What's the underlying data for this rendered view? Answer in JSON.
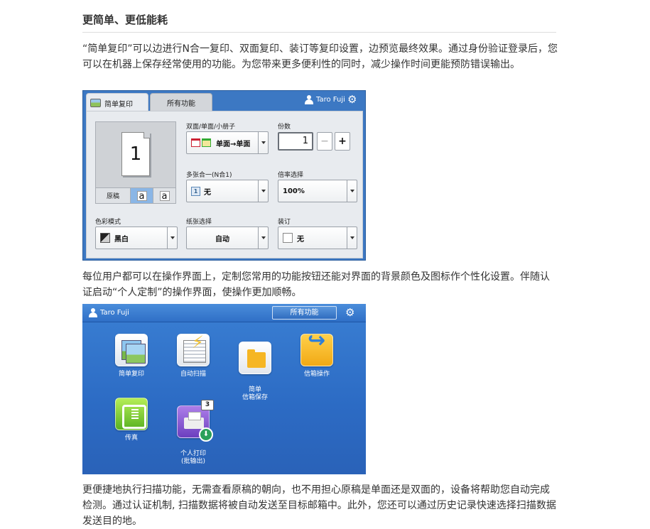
{
  "heading": "更简单、更低能耗",
  "paragraphs": {
    "p1": "“简单复印”可以边进行N合一复印、双面复印、装订等复印设置，边预览最终效果。通过身份验证登录后，您可以在机器上保存经常使用的功能。为您带来更多便利性的同时，减少操作时间更能预防错误输出。",
    "p2": "每位用户都可以在操作界面上，定制您常用的功能按钮还能对界面的背景颜色及图标作个性化设置。伴随认证启动“个人定制”的操作界面，使操作更加顺畅。",
    "p3": "更便捷地执行扫描功能，无需查看原稿的朝向，也不用担心原稿是单面还是双面的，设备将帮助您自动完成检测。通过认证机制, 扫描数据将被自动发送至目标邮箱中。此外，您还可以通过历史记录快速选择扫描数据发送目的地。"
  },
  "screen1": {
    "tabs": {
      "simple_copy": "简单复印",
      "all_functions": "所有功能"
    },
    "user": "Taro Fuji",
    "preview": {
      "page_number": "1",
      "original_label": "原稿",
      "orient_a1": "a",
      "orient_a2": "a"
    },
    "duplex": {
      "label": "双面/单面/小册子",
      "value": "单面→单面"
    },
    "copies": {
      "label": "份数",
      "value": "1",
      "minus": "−",
      "plus": "+"
    },
    "nup": {
      "label": "多张合一(N合1)",
      "value": "无",
      "icon_text": "1"
    },
    "zoom": {
      "label": "倍率选择",
      "value": "100%"
    },
    "color": {
      "label": "色彩模式",
      "value": "黑白"
    },
    "paper": {
      "label": "纸张选择",
      "value": "自动"
    },
    "staple": {
      "label": "装订",
      "value": "无"
    },
    "colors": {
      "frame": "#3c78c3",
      "panel": "#e8ebef",
      "active_orient": "#8ab6e6"
    }
  },
  "screen2": {
    "user": "Taro Fuji",
    "all_functions": "所有功能",
    "apps": [
      {
        "id": "simple-copy",
        "label": "简单复印"
      },
      {
        "id": "auto-scan",
        "label": "自动扫描"
      },
      {
        "id": "simple-mailbox-save",
        "label": "简单\n信箱保存"
      },
      {
        "id": "mailbox-operation",
        "label": "信箱操作"
      },
      {
        "id": "fax",
        "label": "传真"
      },
      {
        "id": "personal-print",
        "label": "个人打印\n(批输出)",
        "badge": "3"
      }
    ],
    "colors": {
      "background": "#2c6bc4"
    }
  }
}
